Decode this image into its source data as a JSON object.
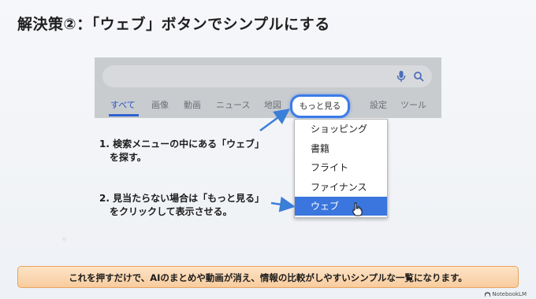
{
  "slide": {
    "title": "解決策②：「ウェブ」ボタンでシンプルにする",
    "banner_text": "これを押すだけで、AIのまとめや動画が消え、情報の比較がしやすいシンプルな一覧になります。",
    "brand": "NotebookLM"
  },
  "search": {
    "tabs": [
      {
        "label": "すべて",
        "active": true
      },
      {
        "label": "画像",
        "active": false
      },
      {
        "label": "動画",
        "active": false
      },
      {
        "label": "ニュース",
        "active": false
      },
      {
        "label": "地図",
        "active": false
      },
      {
        "label": "設定",
        "active": false
      },
      {
        "label": "ツール",
        "active": false
      }
    ],
    "more_button": "もっと見る",
    "icons": {
      "mic": "mic-icon",
      "search": "search-icon"
    },
    "menu_items": [
      {
        "label": "ショッピング",
        "selected": false
      },
      {
        "label": "書籍",
        "selected": false
      },
      {
        "label": "フライト",
        "selected": false
      },
      {
        "label": "ファイナンス",
        "selected": false
      },
      {
        "label": "ウェブ",
        "selected": true
      }
    ]
  },
  "notes": {
    "step1_line1": "1. 検索メニューの中にある「ウェブ」",
    "step1_line2": "を探す。",
    "step2_line1": "2. 見当たらない場合は「もっと見る」",
    "step2_line2": "をクリックして表示させる。"
  },
  "colors": {
    "accent": "#3a76dd",
    "banner": "#f8cc9e",
    "active_tab": "#2456c9"
  }
}
